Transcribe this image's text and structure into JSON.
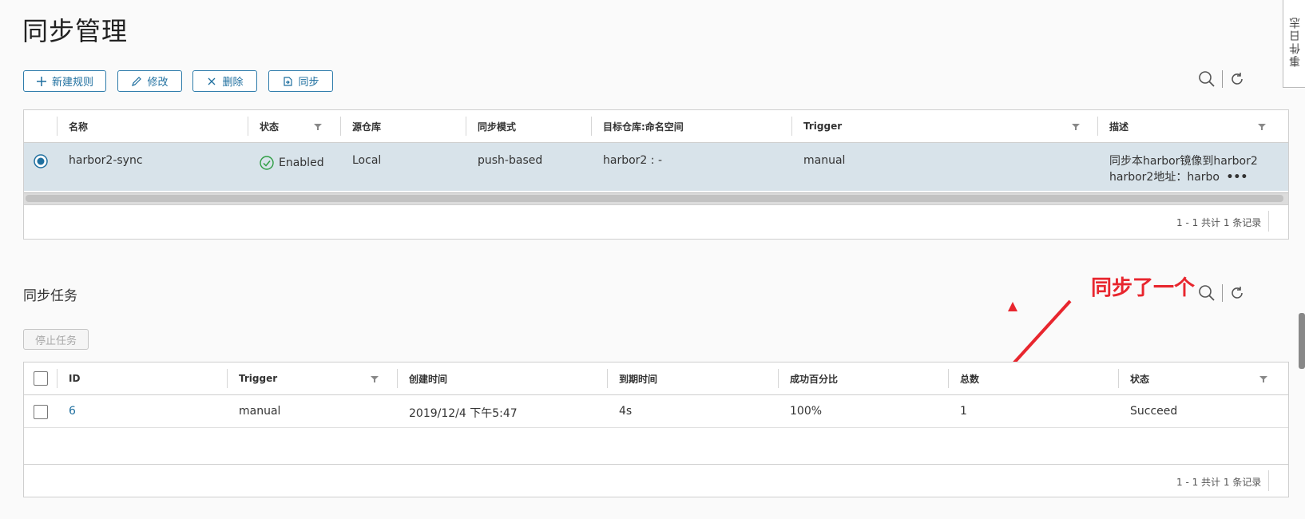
{
  "page": {
    "title": "同步管理"
  },
  "event_log_tab": {
    "label": "事件日志"
  },
  "toolbar": {
    "new_rule": "新建规则",
    "edit": "修改",
    "delete": "删除",
    "sync": "同步"
  },
  "rules_grid": {
    "columns": [
      "名称",
      "状态",
      "源仓库",
      "同步模式",
      "目标仓库:命名空间",
      "Trigger",
      "描述"
    ],
    "row": {
      "name": "harbor2-sync",
      "status": "Enabled",
      "source": "Local",
      "mode": "push-based",
      "target": "harbor2 : -",
      "trigger": "manual",
      "desc_line1": "同步本harbor镜像到harbor2",
      "desc_line2": "harbor2地址：harbo",
      "desc_more": "•••"
    },
    "footer": "1 - 1 共计 1 条记录"
  },
  "tasks": {
    "title": "同步任务",
    "stop_button": "停止任务",
    "columns": [
      "ID",
      "Trigger",
      "创建时间",
      "到期时间",
      "成功百分比",
      "总数",
      "状态"
    ],
    "row": {
      "id": "6",
      "trigger": "manual",
      "created": "2019/12/4 下午5:47",
      "duration": "4s",
      "success": "100%",
      "total": "1",
      "status": "Succeed"
    },
    "footer": "1 - 1 共计 1 条记录"
  },
  "annotation": {
    "text": "同步了一个"
  },
  "colors": {
    "accent": "#1f6f9f",
    "selected_row": "#d8e3ea",
    "annotation": "#e8262e",
    "success": "#2f9e44"
  }
}
